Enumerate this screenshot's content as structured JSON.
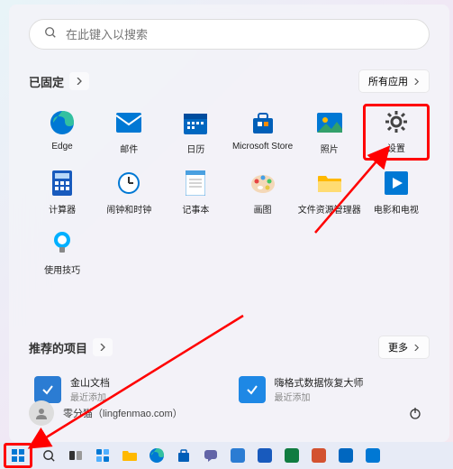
{
  "search": {
    "placeholder": "在此键入以搜索"
  },
  "pinned": {
    "title": "已固定",
    "all_apps_label": "所有应用",
    "apps": [
      {
        "name": "Edge",
        "icon": "edge",
        "color": "#0078d4"
      },
      {
        "name": "邮件",
        "icon": "mail",
        "color": "#0078d4"
      },
      {
        "name": "日历",
        "icon": "calendar",
        "color": "#0067c0"
      },
      {
        "name": "Microsoft Store",
        "icon": "store",
        "color": "#005fb8"
      },
      {
        "name": "照片",
        "icon": "photos",
        "color": "#0078d4"
      },
      {
        "name": "设置",
        "icon": "settings",
        "color": "#444",
        "highlighted": true
      },
      {
        "name": "计算器",
        "icon": "calc",
        "color": "#185abd"
      },
      {
        "name": "闹钟和时钟",
        "icon": "clock",
        "color": "#0078d4"
      },
      {
        "name": "记事本",
        "icon": "notepad",
        "color": "#4aa0e0"
      },
      {
        "name": "画图",
        "icon": "paint",
        "color": "#c74444"
      },
      {
        "name": "文件资源管理器",
        "icon": "explorer",
        "color": "#ffb900"
      },
      {
        "name": "电影和电视",
        "icon": "movies",
        "color": "#0078d4"
      },
      {
        "name": "使用技巧",
        "icon": "tips",
        "color": "#00b0ff"
      }
    ]
  },
  "recommended": {
    "title": "推荐的项目",
    "more_label": "更多",
    "items": [
      {
        "title": "金山文档",
        "subtitle": "最近添加",
        "color": "#2b7cd3"
      },
      {
        "title": "嗨格式数据恢复大师",
        "subtitle": "最近添加",
        "color": "#1e88e5"
      }
    ]
  },
  "user": {
    "display": "零分猫（lingfenmao.com）"
  },
  "taskbar": {
    "buttons": [
      "start",
      "search",
      "taskview",
      "widgets",
      "explorer",
      "edge",
      "store",
      "mail",
      "app1",
      "app2",
      "app3",
      "app4"
    ]
  }
}
